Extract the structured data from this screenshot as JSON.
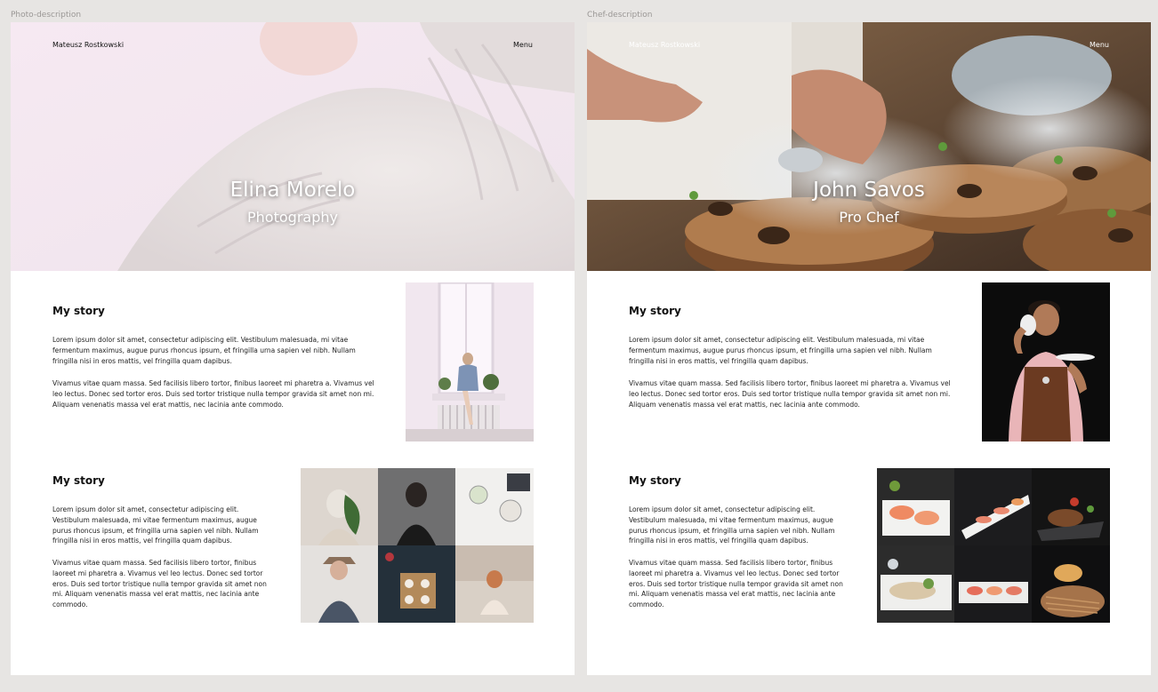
{
  "frames": [
    {
      "label": "Photo-description",
      "nav": {
        "brand": "Mateusz Rostkowski",
        "menu": "Menu"
      },
      "hero": {
        "name": "Elina Morelo",
        "role": "Photography"
      },
      "stories": [
        {
          "title": "My story",
          "p1": "Lorem ipsum dolor sit amet, consectetur adipiscing elit. Vestibulum malesuada, mi vitae fermentum maximus, augue purus rhoncus ipsum, et fringilla urna sapien vel nibh. Nullam fringilla nisi in eros mattis, vel fringilla quam dapibus.",
          "p2": "Vivamus vitae quam massa. Sed facilisis libero tortor, finibus laoreet mi pharetra a. Vivamus vel leo lectus. Donec sed tortor eros. Duis sed tortor tristique nulla tempor gravida sit amet non mi. Aliquam venenatis massa vel erat mattis, nec lacinia ante commodo."
        },
        {
          "title": "My story",
          "p1": "Lorem ipsum dolor sit amet, consectetur adipiscing elit. Vestibulum malesuada, mi vitae fermentum maximus, augue purus rhoncus ipsum, et fringilla urna sapien vel nibh. Nullam fringilla nisi in eros mattis, vel fringilla quam dapibus.",
          "p2": "Vivamus vitae quam massa. Sed facilisis libero tortor, finibus laoreet mi pharetra a. Vivamus vel leo lectus. Donec sed tortor eros. Duis sed tortor tristique nulla tempor gravida sit amet non mi. Aliquam venenatis massa vel erat mattis, nec lacinia ante commodo."
        }
      ]
    },
    {
      "label": "Chef-description",
      "nav": {
        "brand": "Mateusz Rostkowski",
        "menu": "Menu"
      },
      "hero": {
        "name": "John Savos",
        "role": "Pro Chef"
      },
      "stories": [
        {
          "title": "My story",
          "p1": "Lorem ipsum dolor sit amet, consectetur adipiscing elit. Vestibulum malesuada, mi vitae fermentum maximus, augue purus rhoncus ipsum, et fringilla urna sapien vel nibh. Nullam fringilla nisi in eros mattis, vel fringilla quam dapibus.",
          "p2": "Vivamus vitae quam massa. Sed facilisis libero tortor, finibus laoreet mi pharetra a. Vivamus vel leo lectus. Donec sed tortor eros. Duis sed tortor tristique nulla tempor gravida sit amet non mi. Aliquam venenatis massa vel erat mattis, nec lacinia ante commodo."
        },
        {
          "title": "My story",
          "p1": "Lorem ipsum dolor sit amet, consectetur adipiscing elit. Vestibulum malesuada, mi vitae fermentum maximus, augue purus rhoncus ipsum, et fringilla urna sapien vel nibh. Nullam fringilla nisi in eros mattis, vel fringilla quam dapibus.",
          "p2": "Vivamus vitae quam massa. Sed facilisis libero tortor, finibus laoreet mi pharetra a. Vivamus vel leo lectus. Donec sed tortor eros. Duis sed tortor tristique nulla tempor gravida sit amet non mi. Aliquam venenatis massa vel erat mattis, nec lacinia ante commodo."
        }
      ]
    }
  ],
  "colors": {
    "canvas": "#e7e5e3",
    "frame_bg": "#ffffff",
    "frame_label": "#9a9795",
    "text": "#111111",
    "hero_text": "#ffffff"
  }
}
